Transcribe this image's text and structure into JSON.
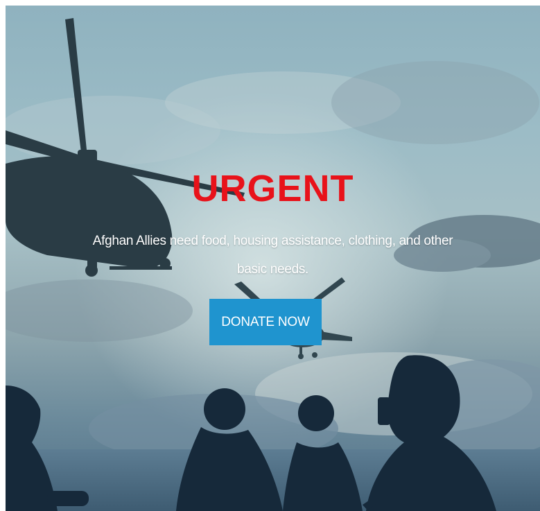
{
  "hero": {
    "headline": "URGENT",
    "subtext": "Afghan Allies need food, housing assistance, clothing, and other basic needs.",
    "cta_label": "DONATE NOW"
  },
  "colors": {
    "headline": "#e8121a",
    "cta_background": "#1f94cf",
    "cta_text": "#ffffff"
  }
}
